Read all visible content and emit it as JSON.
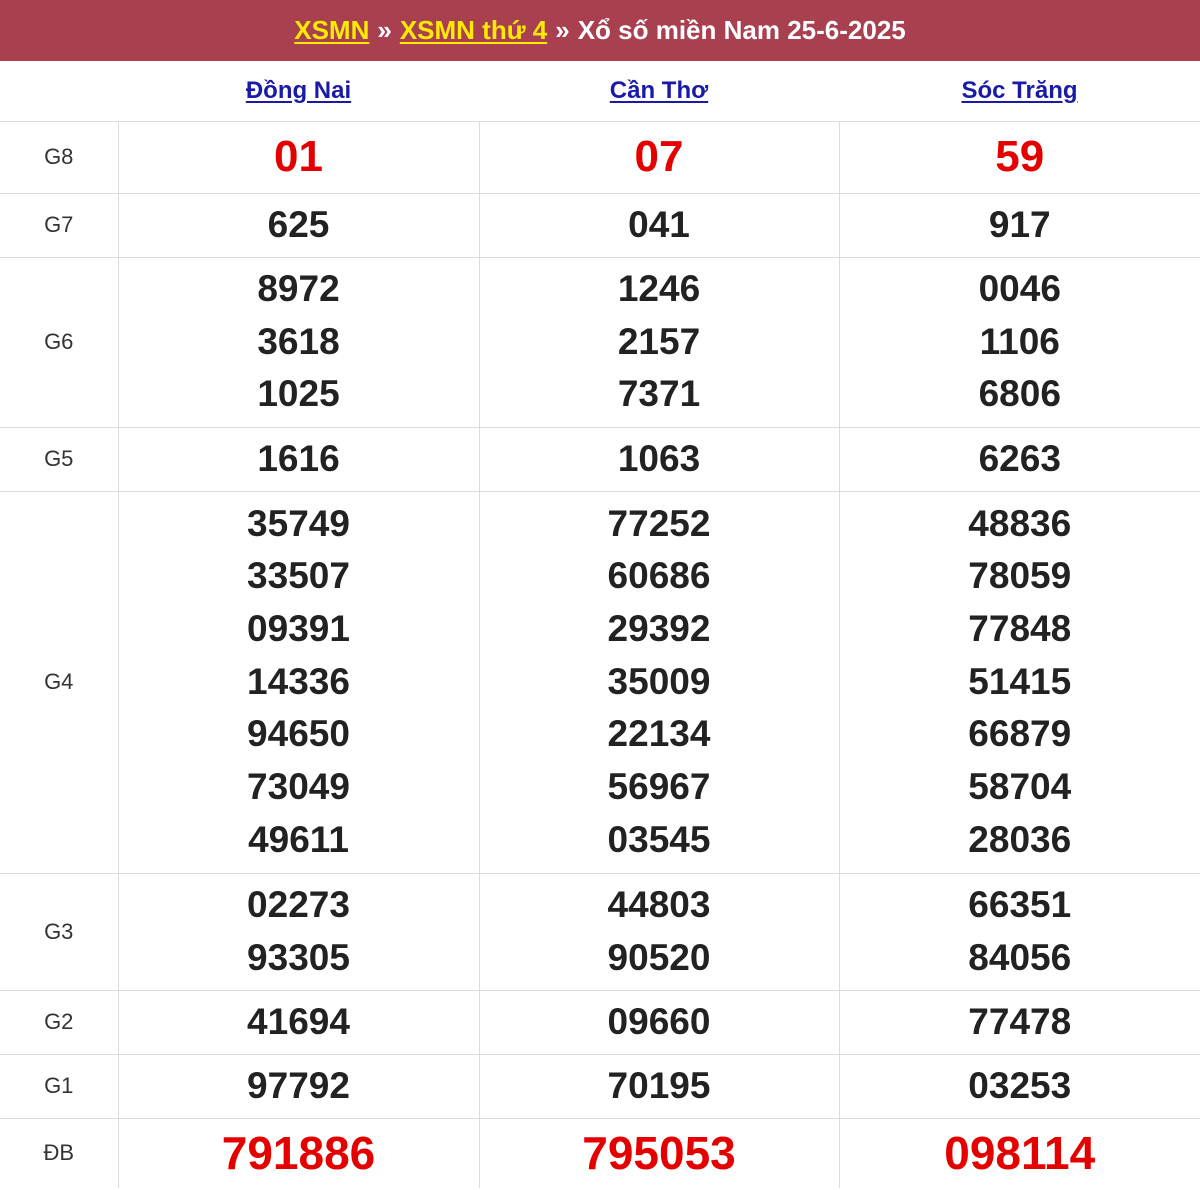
{
  "header": {
    "link1": "XSMN",
    "sep1": "»",
    "link2": "XSMN thứ 4",
    "sep2": "»",
    "title": "Xổ số miền Nam 25-6-2025"
  },
  "provinces": [
    "Đồng Nai",
    "Cần Thơ",
    "Sóc Trăng"
  ],
  "rows": {
    "G8": {
      "label": "G8",
      "values": [
        [
          "01"
        ],
        [
          "07"
        ],
        [
          "59"
        ]
      ]
    },
    "G7": {
      "label": "G7",
      "values": [
        [
          "625"
        ],
        [
          "041"
        ],
        [
          "917"
        ]
      ]
    },
    "G6": {
      "label": "G6",
      "values": [
        [
          "8972",
          "3618",
          "1025"
        ],
        [
          "1246",
          "2157",
          "7371"
        ],
        [
          "0046",
          "1106",
          "6806"
        ]
      ]
    },
    "G5": {
      "label": "G5",
      "values": [
        [
          "1616"
        ],
        [
          "1063"
        ],
        [
          "6263"
        ]
      ]
    },
    "G4": {
      "label": "G4",
      "values": [
        [
          "35749",
          "33507",
          "09391",
          "14336",
          "94650",
          "73049",
          "49611"
        ],
        [
          "77252",
          "60686",
          "29392",
          "35009",
          "22134",
          "56967",
          "03545"
        ],
        [
          "48836",
          "78059",
          "77848",
          "51415",
          "66879",
          "58704",
          "28036"
        ]
      ]
    },
    "G3": {
      "label": "G3",
      "values": [
        [
          "02273",
          "93305"
        ],
        [
          "44803",
          "90520"
        ],
        [
          "66351",
          "84056"
        ]
      ]
    },
    "G2": {
      "label": "G2",
      "values": [
        [
          "41694"
        ],
        [
          "09660"
        ],
        [
          "77478"
        ]
      ]
    },
    "G1": {
      "label": "G1",
      "values": [
        [
          "97792"
        ],
        [
          "70195"
        ],
        [
          "03253"
        ]
      ]
    },
    "DB": {
      "label": "ĐB",
      "values": [
        [
          "791886"
        ],
        [
          "795053"
        ],
        [
          "098114"
        ]
      ]
    }
  },
  "colors": {
    "header_bg": "#a8404f",
    "header_link": "#ffea00",
    "province_link": "#1a1aa8",
    "highlight_red": "#e50000"
  }
}
